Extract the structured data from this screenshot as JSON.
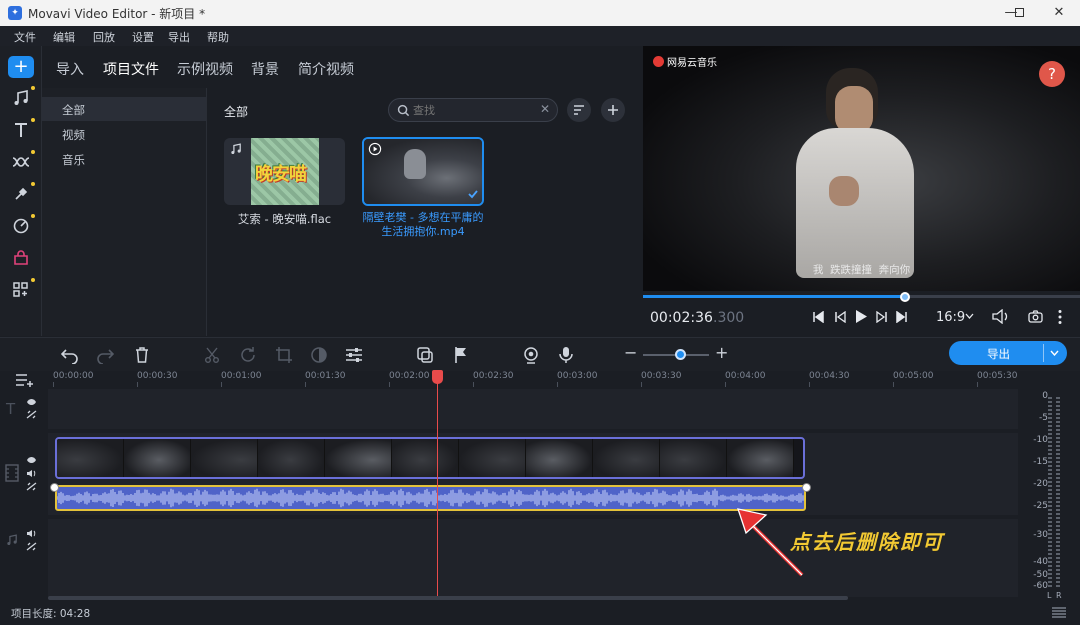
{
  "window": {
    "title": "Movavi Video Editor - 新项目 *"
  },
  "menu": [
    "文件",
    "编辑",
    "回放",
    "设置",
    "导出",
    "帮助"
  ],
  "tabs": [
    "导入",
    "项目文件",
    "示例视频",
    "背景",
    "简介视频"
  ],
  "active_tab": "项目文件",
  "categories": [
    "全部",
    "视频",
    "音乐"
  ],
  "media": {
    "header": "全部",
    "search_placeholder": "查找",
    "items": [
      {
        "name": "艾索 - 晚安喵.flac",
        "type": "audio",
        "art_text": "晚安喵"
      },
      {
        "name": "隔壁老樊 - 多想在平庸的生活拥抱你.mp4",
        "type": "video",
        "selected": true
      }
    ]
  },
  "preview": {
    "brand": "网易云音乐",
    "subtitle": "我  跌跌撞撞  奔向你",
    "help": "?",
    "progress": 0.6
  },
  "player": {
    "time_main": "00:02:36",
    "time_ms": ".300",
    "aspect": "16:9"
  },
  "export": {
    "label": "导出"
  },
  "zoom_level": 0.45,
  "ruler": [
    "00:00:00",
    "00:00:30",
    "00:01:00",
    "00:01:30",
    "00:02:00",
    "00:02:30",
    "00:03:00",
    "00:03:30",
    "00:04:00",
    "00:04:30",
    "00:05:00",
    "00:05:30"
  ],
  "playhead_time_fraction": 0.454,
  "annotation": "点去后删除即可",
  "meter": {
    "scale": [
      "0",
      "-5",
      "-10",
      "-15",
      "-20",
      "-25",
      "-30",
      "-40",
      "-50",
      "-60"
    ],
    "channels": [
      "L",
      "R"
    ]
  },
  "status": {
    "project_length": "项目长度: 04:28"
  },
  "colors": {
    "accent": "#1f8df0",
    "playhead": "#e84b4b",
    "video_clip": "#6a6fd8",
    "audio_clip": "#4f63c8",
    "annotation": "#f2c933"
  }
}
